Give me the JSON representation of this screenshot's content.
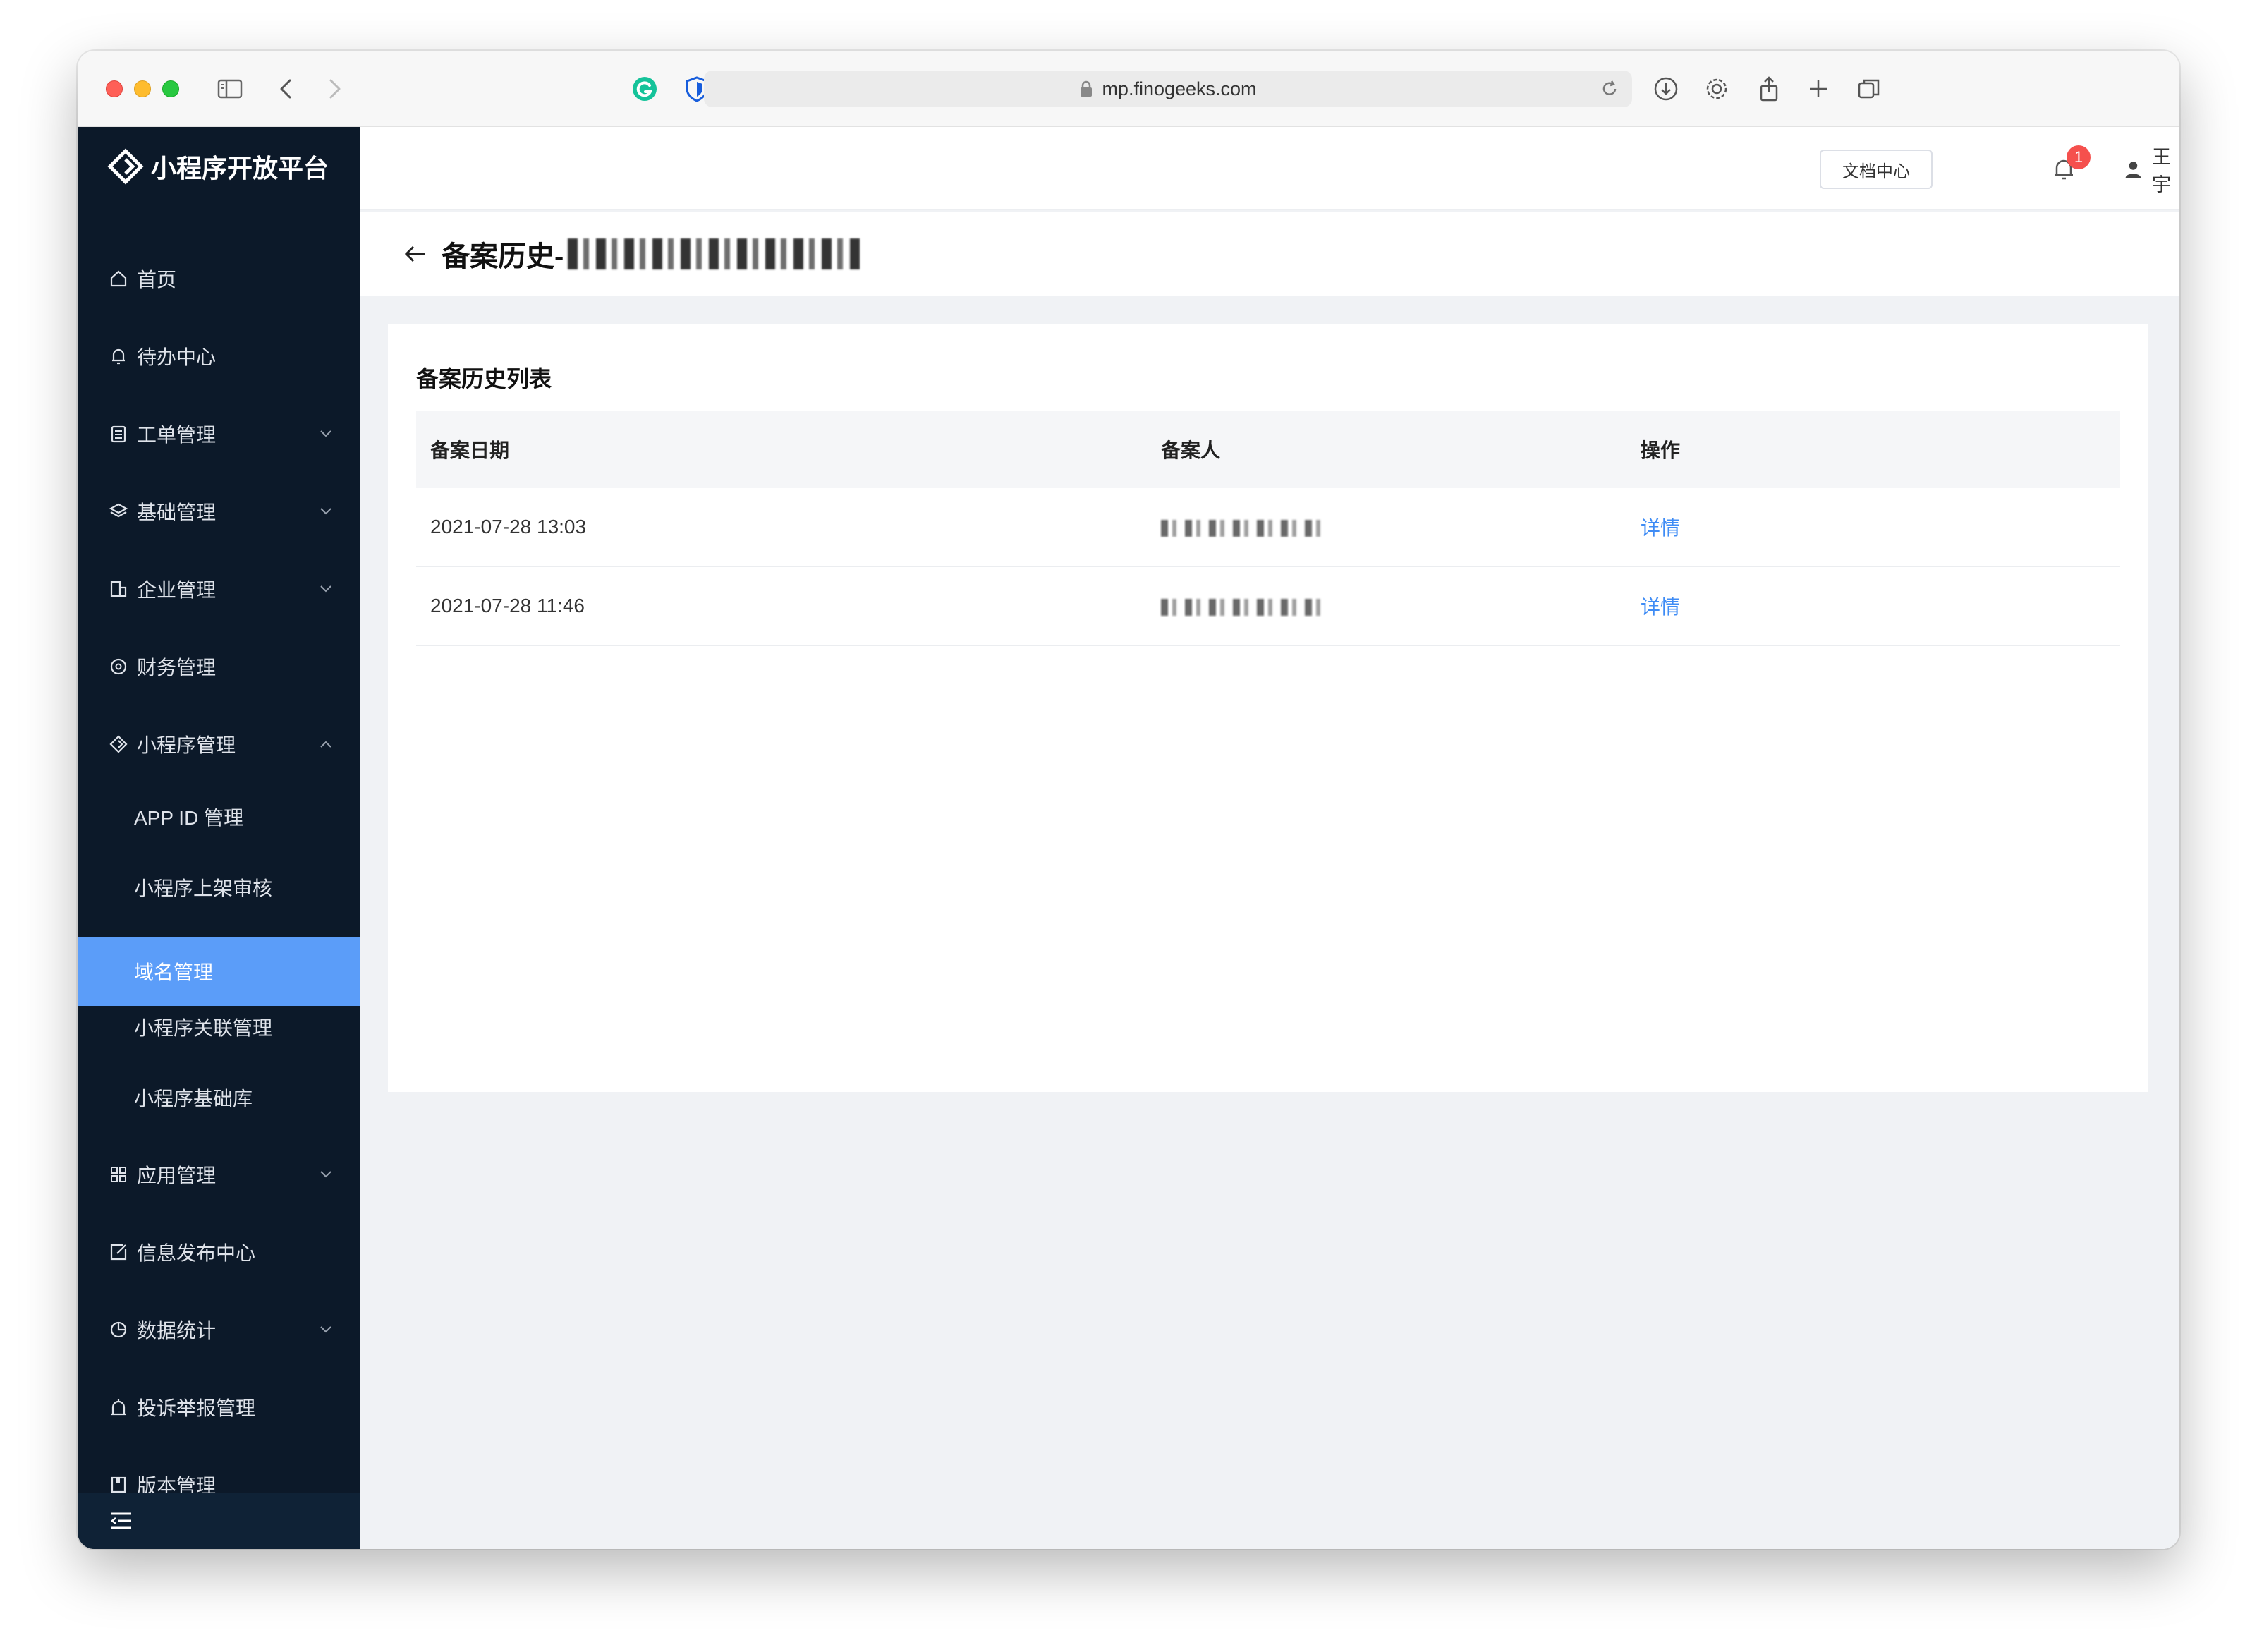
{
  "browser": {
    "url": "mp.finogeeks.com"
  },
  "sidebar": {
    "logo_text": "小程序开放平台",
    "items": [
      {
        "label": "首页",
        "icon": "home-icon"
      },
      {
        "label": "待办中心",
        "icon": "bell-icon"
      },
      {
        "label": "工单管理",
        "icon": "clipboard-icon",
        "expandable": true
      },
      {
        "label": "基础管理",
        "icon": "layers-icon",
        "expandable": true
      },
      {
        "label": "企业管理",
        "icon": "building-icon",
        "expandable": true
      },
      {
        "label": "财务管理",
        "icon": "coin-icon"
      },
      {
        "label": "小程序管理",
        "icon": "miniprogram-icon",
        "expanded": true
      }
    ],
    "sub_items": [
      {
        "label": "APP ID 管理"
      },
      {
        "label": "小程序上架审核"
      },
      {
        "label": "域名管理",
        "active": true
      },
      {
        "label": "小程序关联管理"
      },
      {
        "label": "小程序基础库"
      }
    ],
    "items_after": [
      {
        "label": "应用管理",
        "icon": "grid-icon",
        "expandable": true
      },
      {
        "label": "信息发布中心",
        "icon": "edit-icon"
      },
      {
        "label": "数据统计",
        "icon": "pie-chart-icon",
        "expandable": true
      },
      {
        "label": "投诉举报管理",
        "icon": "alarm-icon"
      },
      {
        "label": "版本管理",
        "icon": "book-icon"
      }
    ],
    "active_color": "#5b9df9",
    "background_color": "#0c1929"
  },
  "topbar": {
    "doc_center_label": "文档中心",
    "notification_count": "1",
    "user_name": "王宇"
  },
  "page": {
    "title": "备案历史-"
  },
  "card": {
    "title": "备案历史列表",
    "columns": [
      "备案日期",
      "备案人",
      "操作"
    ],
    "rows": [
      {
        "date": "2021-07-28 13:03",
        "action": "详情"
      },
      {
        "date": "2021-07-28 11:46",
        "action": "详情"
      }
    ],
    "link_color": "#3f8cf5"
  }
}
